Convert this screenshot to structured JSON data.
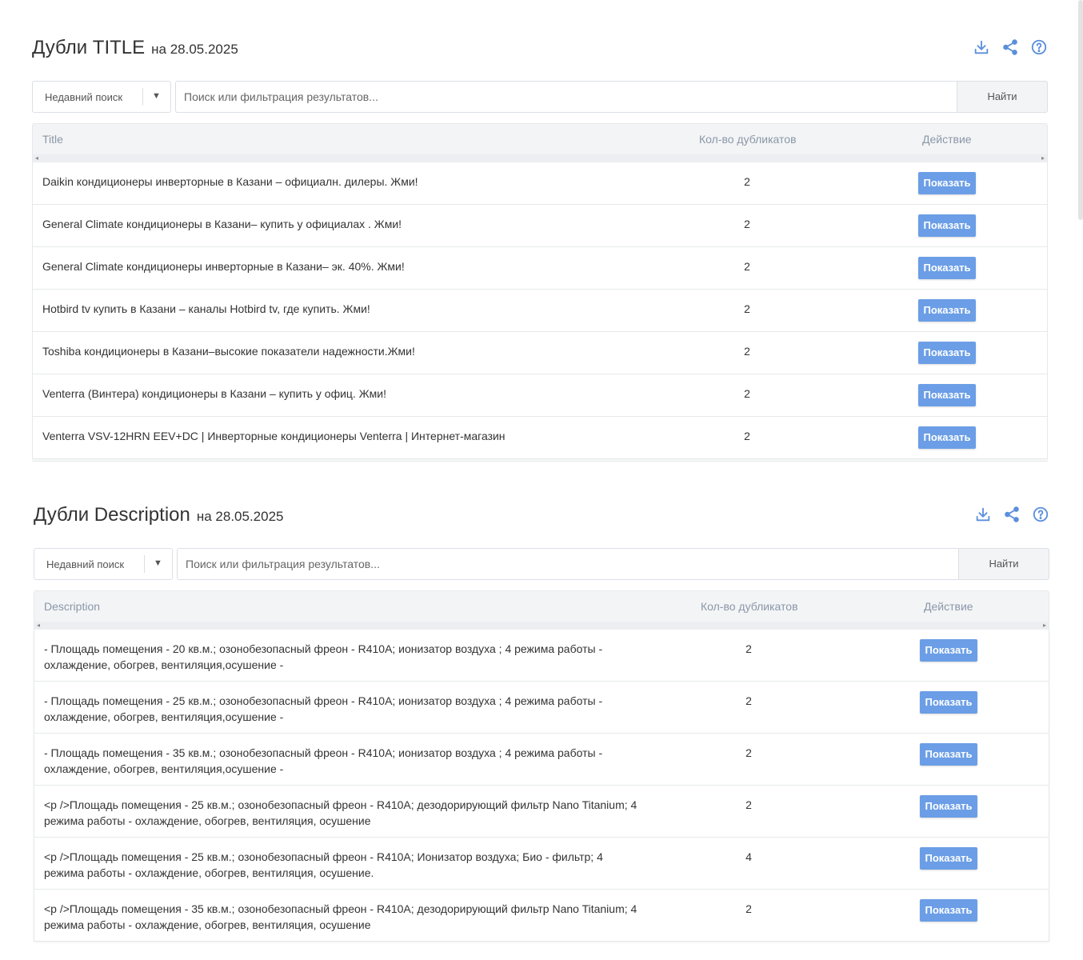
{
  "title_section": {
    "heading": "Дубли TITLE",
    "date": "на 28.05.2025",
    "icons": [
      "download-icon",
      "share-icon",
      "help-icon"
    ],
    "recent_search": "Недавний поиск",
    "search_placeholder": "Поиск или фильтрация результатов...",
    "find_label": "Найти",
    "columns": [
      "Title",
      "Кол-во дубликатов",
      "Действие"
    ],
    "rows": [
      {
        "text": "Daikin кондиционеры инверторные в Казани – официалн. дилеры. Жми!",
        "count": "2",
        "action": "Показать"
      },
      {
        "text": "General Climate кондиционеры в Казани– купить у официалах . Жми!",
        "count": "2",
        "action": "Показать"
      },
      {
        "text": "General Climate кондиционеры инверторные в Казани– эк. 40%. Жми!",
        "count": "2",
        "action": "Показать"
      },
      {
        "text": "Hotbird tv купить в Казани – каналы Hotbird tv, где купить. Жми!",
        "count": "2",
        "action": "Показать"
      },
      {
        "text": "Toshiba кондиционеры в Казани–высокие показатели надежности.Жми!",
        "count": "2",
        "action": "Показать"
      },
      {
        "text": "Venterra (Винтера) кондиционеры в Казани – купить у офиц. Жми!",
        "count": "2",
        "action": "Показать"
      },
      {
        "text": "Venterra VSV-12HRN EEV+DC | Инверторные кондиционеры Venterra | Интернет-магазин",
        "count": "2",
        "action": "Показать"
      }
    ]
  },
  "description_section": {
    "heading": "Дубли Description",
    "date": "на 28.05.2025",
    "icons": [
      "download-icon",
      "share-icon",
      "help-icon"
    ],
    "recent_search": "Недавний поиск",
    "search_placeholder": "Поиск или фильтрация результатов...",
    "find_label": "Найти",
    "columns": [
      "Description",
      "Кол-во дубликатов",
      "Действие"
    ],
    "rows": [
      {
        "line1": "- Площадь помещения - 20 кв.м.; озонобезопасный фреон - R410A; ионизатор воздуха ; 4 режима работы -",
        "line2": "охлаждение, обогрев, вентиляция,осушение -",
        "count": "2",
        "action": "Показать"
      },
      {
        "line1": "- Площадь помещения - 25 кв.м.; озонобезопасный фреон - R410A; ионизатор воздуха ; 4 режима работы -",
        "line2": "охлаждение, обогрев, вентиляция,осушение -",
        "count": "2",
        "action": "Показать"
      },
      {
        "line1": "- Площадь помещения - 35 кв.м.; озонобезопасный фреон - R410A; ионизатор воздуха ; 4 режима работы -",
        "line2": "охлаждение, обогрев, вентиляция,осушение -",
        "count": "2",
        "action": "Показать"
      },
      {
        "line1": "<p />Площадь помещения - 25 кв.м.; озонобезопасный фреон - R410A; дезодорирующий фильтр Nano Titanium; 4",
        "line2": "режима работы - охлаждение, обогрев, вентиляция, осушение",
        "count": "2",
        "action": "Показать"
      },
      {
        "line1": "<p />Площадь помещения - 25 кв.м.; озонобезопасный фреон - R410A; Ионизатор воздуха; Био - фильтр; 4",
        "line2": "режима работы - охлаждение, обогрев, вентиляция, осушение.",
        "count": "4",
        "action": "Показать"
      },
      {
        "line1": "<p />Площадь помещения - 35 кв.м.; озонобезопасный фреон - R410A; дезодорирующий фильтр Nano Titanium; 4",
        "line2": "режима работы - охлаждение, обогрев, вентиляция, осушение",
        "count": "2",
        "action": "Показать"
      }
    ]
  },
  "colors": {
    "accent": "#6b9ee6",
    "icon": "#5b8fdc",
    "header_bg": "#f3f4f6",
    "column_header": "#8a97a8"
  }
}
